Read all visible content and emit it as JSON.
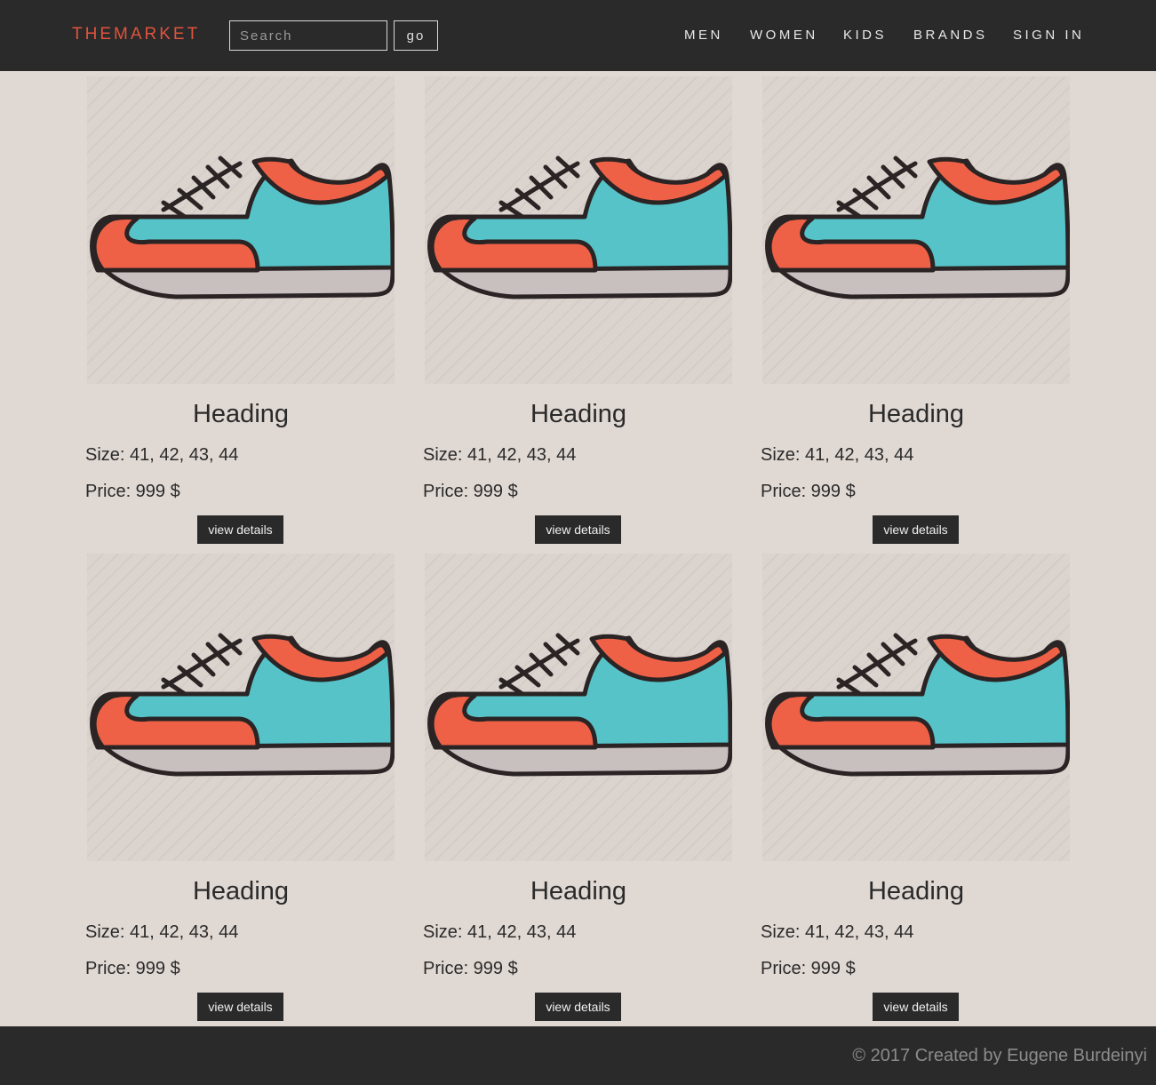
{
  "header": {
    "logo": "THEMARKET",
    "search": {
      "placeholder": "Search",
      "value": ""
    },
    "go_label": "go",
    "nav": [
      "MEN",
      "WOMEN",
      "KIDS",
      "BRANDS",
      "SIGN IN"
    ]
  },
  "products": [
    {
      "heading": "Heading",
      "size": "Size: 41, 42, 43, 44",
      "price": "Price: 999 $",
      "button": "view details"
    },
    {
      "heading": "Heading",
      "size": "Size: 41, 42, 43, 44",
      "price": "Price: 999 $",
      "button": "view details"
    },
    {
      "heading": "Heading",
      "size": "Size: 41, 42, 43, 44",
      "price": "Price: 999 $",
      "button": "view details"
    },
    {
      "heading": "Heading",
      "size": "Size: 41, 42, 43, 44",
      "price": "Price: 999 $",
      "button": "view details"
    },
    {
      "heading": "Heading",
      "size": "Size: 41, 42, 43, 44",
      "price": "Price: 999 $",
      "button": "view details"
    },
    {
      "heading": "Heading",
      "size": "Size: 41, 42, 43, 44",
      "price": "Price: 999 $",
      "button": "view details"
    }
  ],
  "footer": {
    "copyright": "© 2017 Created by Eugene Burdeinyi"
  },
  "colors": {
    "header_bg": "#2a2a2a",
    "logo": "#e0533e",
    "page_bg": "#e0d8d3",
    "shoe_body": "#56c3c9",
    "shoe_accent": "#ef6147",
    "shoe_sole": "#c8bfbf"
  }
}
